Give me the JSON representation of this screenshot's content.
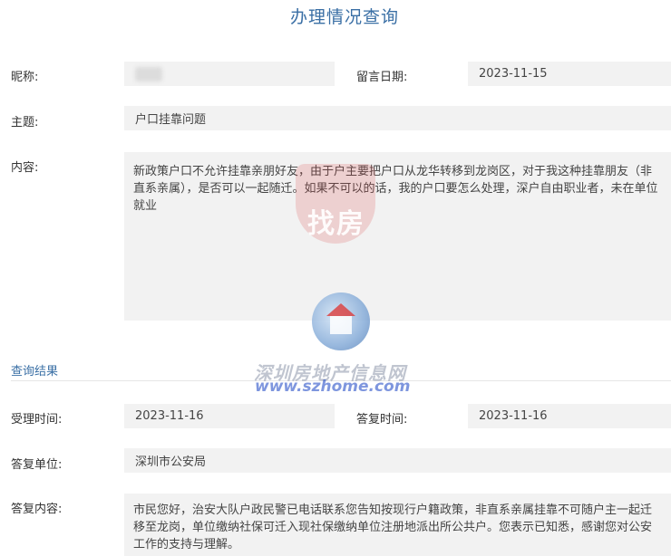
{
  "page": {
    "title": "办理情况查询"
  },
  "fields": {
    "nickname_label": "昵称:",
    "leave_date_label": "留言日期:",
    "leave_date_value": "2023-11-15",
    "topic_label": "主题:",
    "topic_value": "户口挂靠问题",
    "content_label": "内容:",
    "content_value": "新政策户口不允许挂靠亲朋好友，由于户主要把户口从龙华转移到龙岗区，对于我这种挂靠朋友（非直系亲属），是否可以一起随迁。如果不可以的话，我的户口要怎么处理，深户自由职业者，未在单位就业"
  },
  "result": {
    "section_title": "查询结果",
    "accept_time_label": "受理时间:",
    "accept_time_value": "2023-11-16",
    "reply_time_label": "答复时间:",
    "reply_time_value": "2023-11-16",
    "reply_unit_label": "答复单位:",
    "reply_unit_value": "深圳市公安局",
    "reply_content_label": "答复内容:",
    "reply_content_value": "市民您好，治安大队户政民警已电话联系您告知按现行户籍政策，非直系亲属挂靠不可随户主一起迁移至龙岗，单位缴纳社保可迁入现社保缴纳单位注册地派出所公共户。您表示已知悉，感谢您对公安工作的支持与理解。"
  },
  "watermark": {
    "badge_text": "找房",
    "site_name": "深圳房地产信息网",
    "site_url": "www.szhome.com",
    "brand_color": "#3a6fa5"
  }
}
